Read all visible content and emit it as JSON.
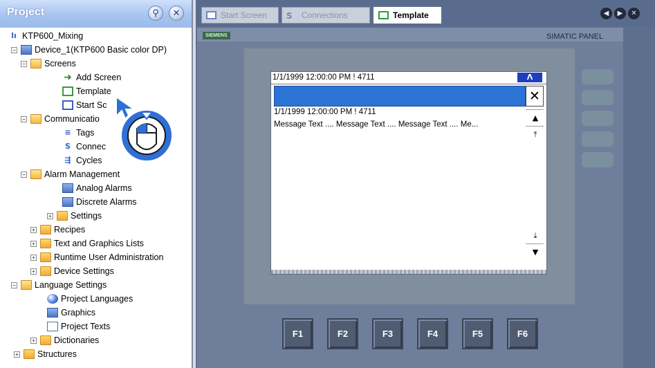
{
  "project_panel": {
    "title": "Project",
    "pin_icon": "pin-icon",
    "close_icon": "close-icon"
  },
  "tree": {
    "root": "KTP600_Mixing",
    "device": "Device_1(KTP600 Basic color DP)",
    "screens": "Screens",
    "add_screen": "Add Screen",
    "template": "Template",
    "start_screen": "Start Sc",
    "communication": "Communicatio",
    "tags": "Tags",
    "connections": "Connec",
    "cycles": "Cycles",
    "alarm_management": "Alarm Management",
    "analog_alarms": "Analog Alarms",
    "discrete_alarms": "Discrete Alarms",
    "settings": "Settings",
    "recipes": "Recipes",
    "text_graphics_lists": "Text and Graphics Lists",
    "runtime_user_admin": "Runtime User Administration",
    "device_settings": "Device Settings",
    "language_settings": "Language Settings",
    "project_languages": "Project Languages",
    "graphics": "Graphics",
    "project_texts": "Project Texts",
    "dictionaries": "Dictionaries",
    "structures": "Structures"
  },
  "tabs": [
    {
      "label": "Start Screen"
    },
    {
      "label": "Connections"
    },
    {
      "label": "Template"
    }
  ],
  "device": {
    "brand": "SIEMENS",
    "model": "SIMATIC PANEL"
  },
  "alarm": {
    "title_line": "1/1/1999 12:00:00 PM ! 4711",
    "collapse_glyph": "Λ",
    "close_glyph": "✕",
    "entry_line1": "1/1/1999 12:00:00 PM ! 4711",
    "entry_line2": "Message Text .... Message Text .... Message Text .... Me...",
    "scroll_up": "▲",
    "scroll_top": "⤒",
    "scroll_bottom": "⤓",
    "scroll_down": "▼"
  },
  "fkeys": [
    "F1",
    "F2",
    "F3",
    "F4",
    "F5",
    "F6"
  ],
  "colors": {
    "selection": "#2b74d6",
    "tab_active": "#ffffff",
    "header": "#a8c4ef"
  }
}
